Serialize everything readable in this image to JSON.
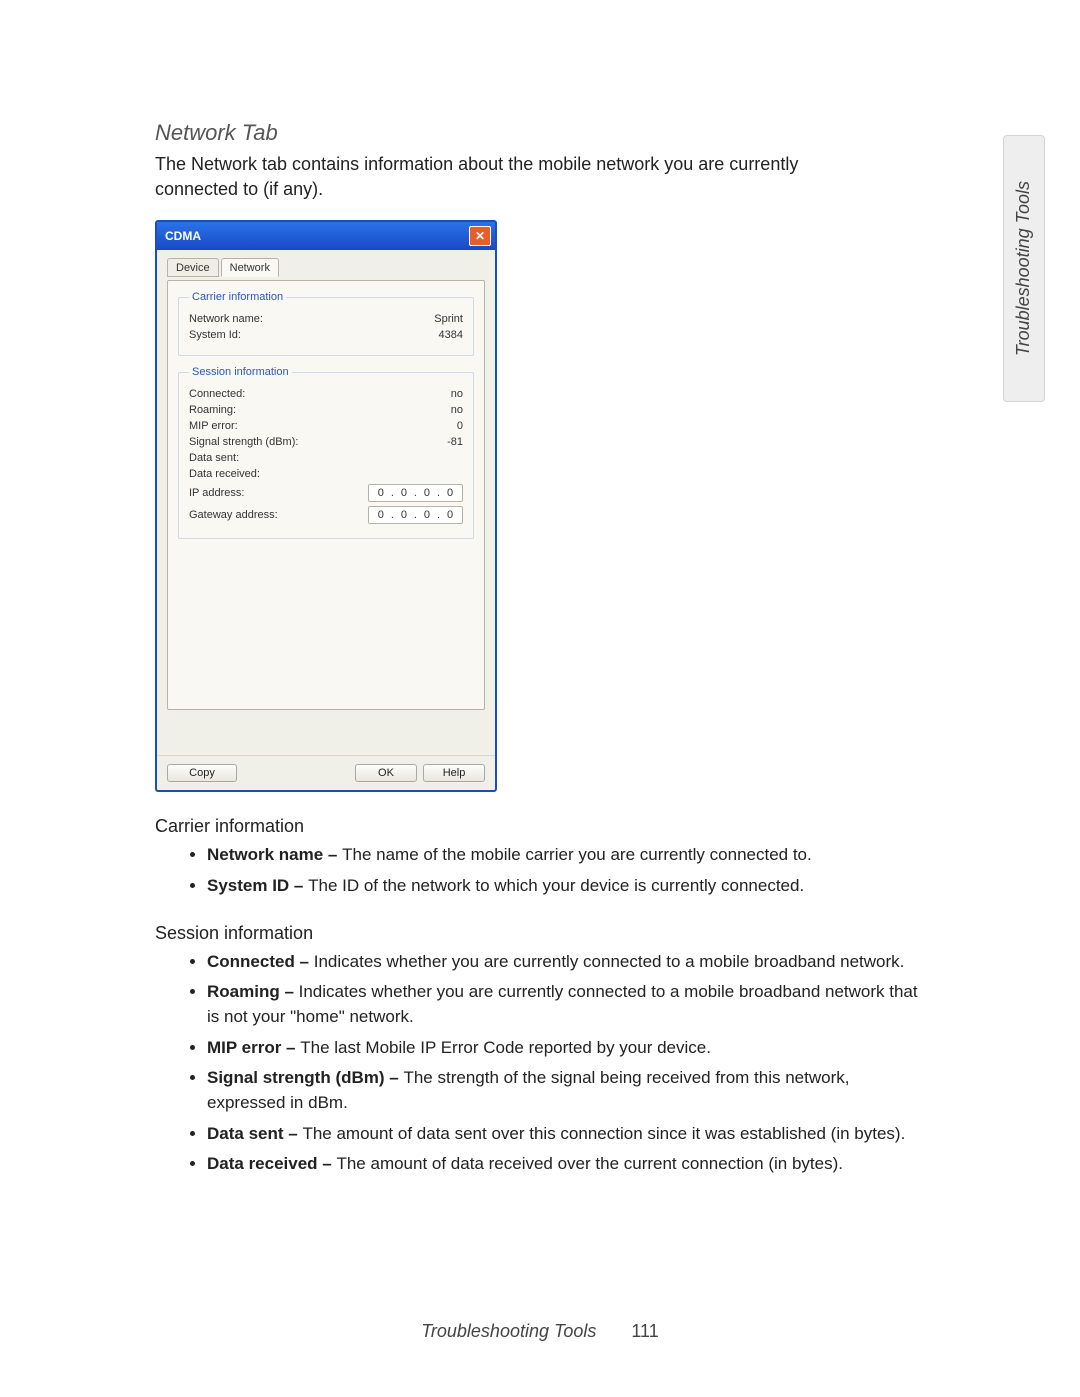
{
  "sideTab": "Troubleshooting Tools",
  "heading": "Network Tab",
  "intro": "The Network tab contains information about the mobile network you are currently connected to (if any).",
  "dialog": {
    "title": "CDMA",
    "tabs": [
      "Device",
      "Network"
    ],
    "carrier": {
      "legend": "Carrier information",
      "rows": [
        {
          "label": "Network name:",
          "value": "Sprint"
        },
        {
          "label": "System Id:",
          "value": "4384"
        }
      ]
    },
    "session": {
      "legend": "Session information",
      "rows": [
        {
          "label": "Connected:",
          "value": "no"
        },
        {
          "label": "Roaming:",
          "value": "no"
        },
        {
          "label": "MIP error:",
          "value": "0"
        },
        {
          "label": "Signal strength (dBm):",
          "value": "-81"
        },
        {
          "label": "Data sent:",
          "value": ""
        },
        {
          "label": "Data received:",
          "value": ""
        },
        {
          "label": "IP address:",
          "octets": [
            "0",
            "0",
            "0",
            "0"
          ]
        },
        {
          "label": "Gateway address:",
          "octets": [
            "0",
            "0",
            "0",
            "0"
          ]
        }
      ]
    },
    "buttons": {
      "copy": "Copy",
      "ok": "OK",
      "help": "Help"
    }
  },
  "desc": {
    "carrier": {
      "heading": "Carrier information",
      "items": [
        {
          "term": "Network name – ",
          "text": "The name of the mobile carrier you are currently connected to."
        },
        {
          "term": "System ID – ",
          "text": "The ID of the network to which your device is currently connected."
        }
      ]
    },
    "session": {
      "heading": "Session information",
      "items": [
        {
          "term": "Connected – ",
          "text": "Indicates whether you are currently connected to a mobile broadband network."
        },
        {
          "term": "Roaming – ",
          "text": "Indicates whether you are currently connected to a mobile broadband network that is not your \"home\" network."
        },
        {
          "term": "MIP error – ",
          "text": "The last Mobile IP Error Code reported by your device."
        },
        {
          "term": "Signal strength (dBm) – ",
          "text": "The strength of the signal being received from this network, expressed in dBm."
        },
        {
          "term": "Data sent – ",
          "text": "The amount of data sent over this connection since it was established (in bytes)."
        },
        {
          "term": "Data received – ",
          "text": "The amount of data received over the current connection (in bytes)."
        }
      ]
    }
  },
  "footer": {
    "title": "Troubleshooting Tools",
    "page": "111"
  }
}
